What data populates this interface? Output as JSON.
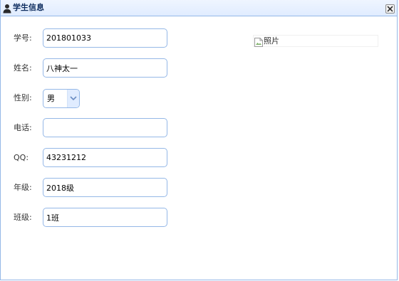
{
  "window": {
    "title": "学生信息",
    "title_icon": "user-icon",
    "close_icon": "close-icon"
  },
  "form": {
    "student_id": {
      "label": "学号:",
      "value": "201801033"
    },
    "name": {
      "label": "姓名:",
      "value": "八神太一"
    },
    "gender": {
      "label": "性别:",
      "value": "男"
    },
    "phone": {
      "label": "电话:",
      "value": ""
    },
    "qq": {
      "label": "QQ:",
      "value": "43231212"
    },
    "grade": {
      "label": "年级:",
      "value": "2018级"
    },
    "class": {
      "label": "班级:",
      "value": "1班"
    }
  },
  "photo": {
    "alt": "照片",
    "icon": "broken-image-icon"
  },
  "colors": {
    "border": "#95b8e7",
    "titlebar": "#e0ecff",
    "title_text": "#0e2d5f"
  }
}
